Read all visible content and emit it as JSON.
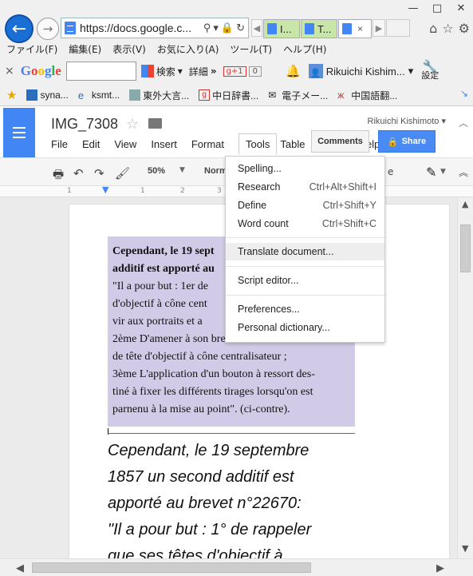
{
  "browser": {
    "url": "https://docs.google.c...",
    "tabs": [
      "I...",
      "T..."
    ],
    "active_tab_close": "×",
    "window_controls": [
      "—",
      "□",
      "✕"
    ]
  },
  "menubar": [
    "ファイル(F)",
    "編集(E)",
    "表示(V)",
    "お気に入り(A)",
    "ツール(T)",
    "ヘルプ(H)"
  ],
  "google_toolbar": {
    "close": "×",
    "logo": "Google",
    "search_button": "検索",
    "detail": "詳細",
    "more": "»",
    "gplus": "g+1",
    "gplus_count": "0",
    "user": "Rikuichi Kishim...",
    "settings": "設定"
  },
  "favorites": [
    "syna...",
    "ksmt...",
    "東外大言...",
    "中日辞書...",
    "電子メー...",
    "中国語翻..."
  ],
  "docs": {
    "title": "IMG_7308",
    "owner": "Rikuichi Kishimoto ▾",
    "menu": [
      "File",
      "Edit",
      "View",
      "Insert",
      "Format",
      "Tools",
      "Table",
      "A"
    ],
    "help_partial": "elp",
    "comments": "Comments",
    "share": "Share",
    "zoom": "50%",
    "styles_partial": "Norm",
    "toolbar_e": "e"
  },
  "tools_menu": {
    "spelling": "Spelling...",
    "research": "Research",
    "research_sc": "Ctrl+Alt+Shift+I",
    "define": "Define",
    "define_sc": "Ctrl+Shift+Y",
    "word_count": "Word count",
    "word_count_sc": "Ctrl+Shift+C",
    "translate": "Translate document...",
    "script_editor": "Script editor...",
    "preferences": "Preferences...",
    "personal_dictionary": "Personal dictionary..."
  },
  "scan_lines": [
    "Cependant, le 19 sept",
    "additif est apporté au",
    "\"Il  a pour but : 1er de",
    "d'objectif à cône cent",
    "vir aux portraits et a",
    "2ème D'amener à son brevet un nouveau modèle",
    "de tête d'objectif à cône centralisateur ;",
    "3ème L'application d'un bouton à ressort des-",
    "tiné à fixer les différents tirages lorsqu'on est",
    "parnenu à la mise au point\". (ci-contre)."
  ],
  "body_lines": [
    "Cependant, le 19 septembre",
    "1857 un second additif est",
    "apporté au brevet n°22670:",
    "\"Il a pour but : 1° de rappeler",
    "que ses têtes d'objectif à"
  ],
  "ruler_numbers": [
    "1",
    "1",
    "2",
    "3"
  ]
}
